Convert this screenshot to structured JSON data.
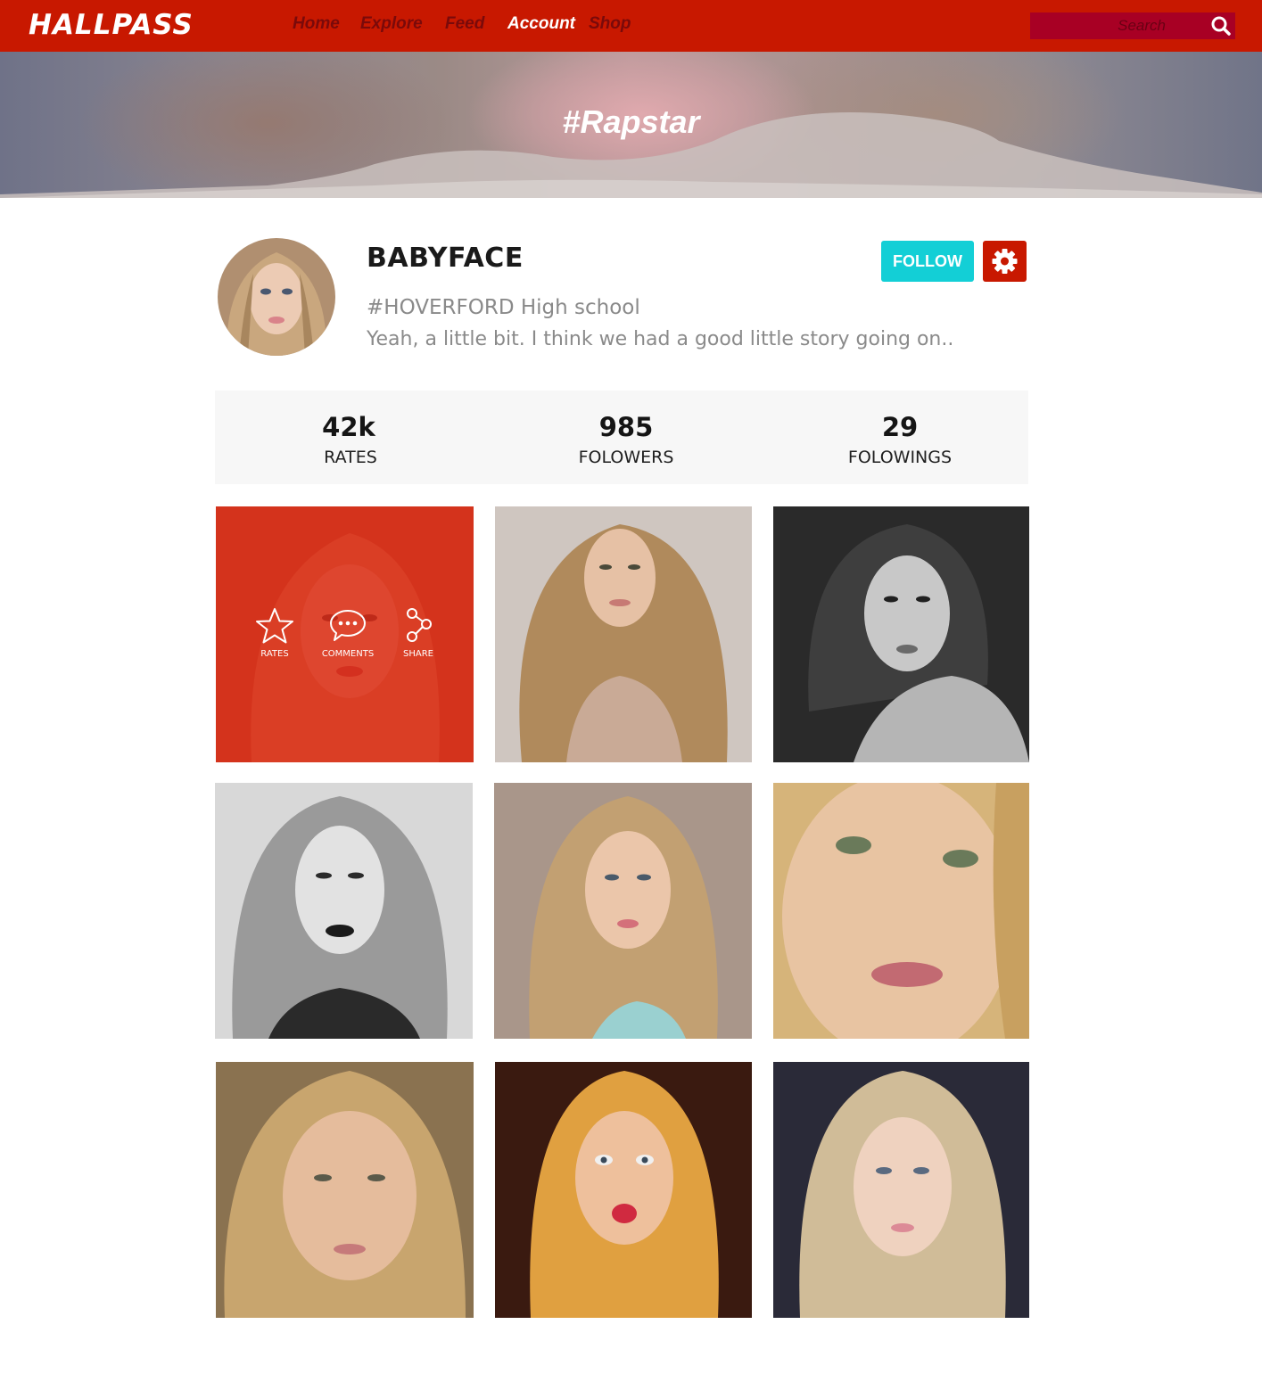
{
  "app": {
    "logo": "HALLPASS"
  },
  "nav": {
    "items": [
      {
        "label": "Home",
        "active": false
      },
      {
        "label": "Explore",
        "active": false
      },
      {
        "label": "Feed",
        "active": false
      },
      {
        "label": "Account",
        "active": true
      },
      {
        "label": "Shop",
        "active": false
      }
    ],
    "search_placeholder": "Search",
    "search_icon": "search-icon"
  },
  "hero": {
    "title": "#Rapstar"
  },
  "profile": {
    "username": "BABYFACE",
    "school": "#HOVERFORD High school",
    "bio": "Yeah, a little bit. I think we had a good little story going on..",
    "follow_label": "FOLLOW",
    "settings_icon": "gear-icon"
  },
  "stats": [
    {
      "value": "42k",
      "label": "RATES"
    },
    {
      "value": "985",
      "label": "FOLOWERS"
    },
    {
      "value": "29",
      "label": "FOLOWINGS"
    }
  ],
  "tile_overlay": {
    "rates_label": "RATES",
    "comments_label": "COMMENTS",
    "share_label": "SHARE"
  },
  "colors": {
    "brand_red": "#c81800",
    "search_bg": "#a80024",
    "follow_teal": "#13cfd6",
    "stats_bg": "#f7f7f7",
    "overlay_red": "#dc2d19"
  }
}
